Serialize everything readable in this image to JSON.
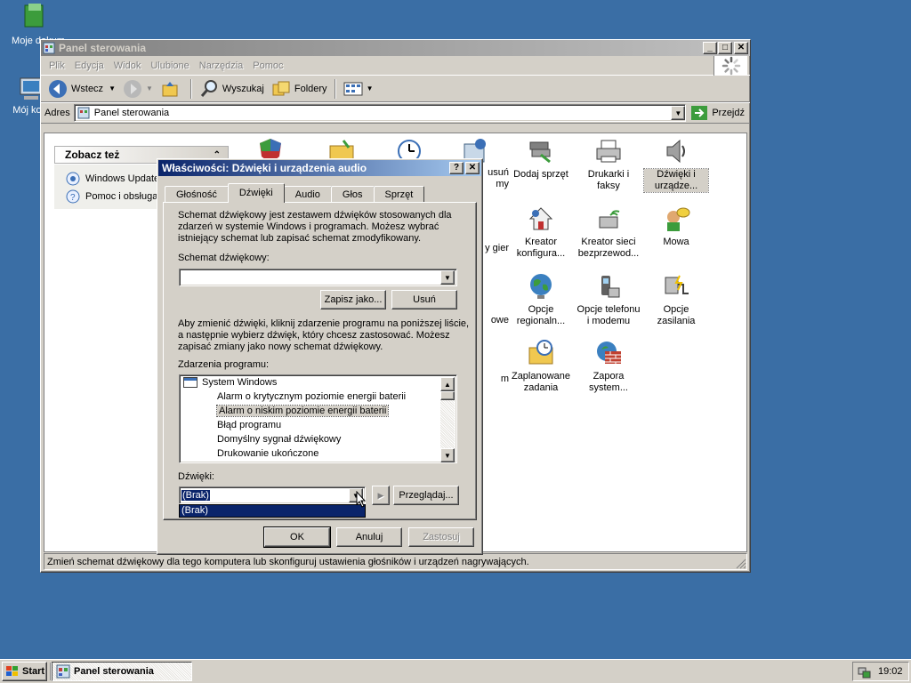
{
  "desktop": {
    "icons": [
      {
        "label": "Moje dokum",
        "icon": "my-documents-icon"
      },
      {
        "label": "Mój kom",
        "icon": "my-computer-icon"
      }
    ]
  },
  "window": {
    "title": "Panel sterowania",
    "controls": [
      "_",
      "□",
      "✕"
    ],
    "menu": [
      "Plik",
      "Edycja",
      "Widok",
      "Ulubione",
      "Narzędzia",
      "Pomoc"
    ],
    "toolbar": {
      "back": "Wstecz",
      "search": "Wyszukaj",
      "folders": "Foldery"
    },
    "address": {
      "label": "Adres",
      "value": "Panel sterowania",
      "go": "Przejdź"
    },
    "sidebar": {
      "title": "Zobacz też",
      "items": [
        "Windows Update",
        "Pomoc i obsługa"
      ]
    },
    "icons": [
      {
        "label": "usuń\nmy",
        "icon": "add-remove-icon"
      },
      {
        "label": "Dodaj sprzęt",
        "icon": "add-hardware-icon"
      },
      {
        "label": "Drukarki i\nfaksy",
        "icon": "printer-icon"
      },
      {
        "label": "Dźwięki i\nurządze...",
        "icon": "speaker-icon"
      },
      {
        "label": "y gier",
        "icon": "game-controller-icon"
      },
      {
        "label": "Kreator\nkonfigura...",
        "icon": "network-wizard-icon"
      },
      {
        "label": "Kreator sieci\nbezprzewod...",
        "icon": "wireless-icon"
      },
      {
        "label": "Mowa",
        "icon": "speech-icon"
      },
      {
        "label": "owe",
        "icon": "fonts-icon"
      },
      {
        "label": "Opcje\nregionaln...",
        "icon": "globe-icon"
      },
      {
        "label": "Opcje telefonu\ni modemu",
        "icon": "phone-icon"
      },
      {
        "label": "Opcje zasilania",
        "icon": "power-icon"
      },
      {
        "label": "m",
        "icon": "system-icon"
      },
      {
        "label": "Zaplanowane\nzadania",
        "icon": "scheduled-tasks-icon"
      },
      {
        "label": "Zapora\nsystem...",
        "icon": "firewall-icon"
      }
    ],
    "status": "Zmień schemat dźwiękowy dla tego komputera lub skonfiguruj ustawienia głośników i urządzeń nagrywających."
  },
  "dialog": {
    "title": "Właściwości: Dźwięki i urządzenia audio",
    "tabs": [
      "Głośność",
      "Dźwięki",
      "Audio",
      "Głos",
      "Sprzęt"
    ],
    "active_tab": "Dźwięki",
    "intro": "Schemat dźwiękowy jest zestawem dźwięków stosowanych dla zdarzeń w systemie Windows i programach. Możesz wybrać istniejący schemat lub zapisać schemat zmodyfikowany.",
    "scheme_label": "Schemat dźwiękowy:",
    "scheme_value": "",
    "save_as": "Zapisz jako...",
    "delete": "Usuń",
    "instructions": "Aby zmienić dźwięki, kliknij zdarzenie programu na poniższej liście, a następnie wybierz dźwięk, który chcesz zastosować. Możesz zapisać zmiany jako nowy schemat dźwiękowy.",
    "events_label": "Zdarzenia programu:",
    "events_root": "System Windows",
    "events": [
      "Alarm o krytycznym poziomie energii baterii",
      "Alarm o niskim poziomie energii baterii",
      "Błąd programu",
      "Domyślny sygnał dźwiękowy",
      "Drukowanie ukończone"
    ],
    "selected_event_index": 1,
    "sounds_label": "Dźwięki:",
    "sound_value": "(Brak)",
    "dropdown_option": "(Brak)",
    "browse": "Przeglądaj...",
    "ok": "OK",
    "cancel": "Anuluj",
    "apply": "Zastosuj"
  },
  "taskbar": {
    "start": "Start",
    "task": "Panel sterowania",
    "clock": "19:02"
  },
  "colors": {
    "desktop": "#3a6ea5",
    "face": "#d4d0c8",
    "active_title": "#0a246a",
    "selection": "#0a246a"
  }
}
